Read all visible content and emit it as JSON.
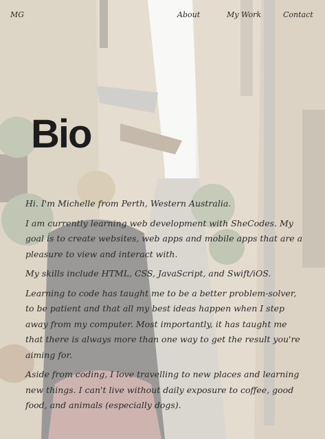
{
  "nav": {
    "brand": "MG",
    "links": [
      "About",
      "My Work",
      "Contact"
    ]
  },
  "page": {
    "title": "Bio"
  },
  "bio": {
    "paragraphs": [
      "Hi. I'm Michelle from Perth, Western Australia.",
      "I am currently learning web development with SheCodes. My goal is to create websites, web apps and mobile apps that are a pleasure to view and interact with.",
      "My skills include HTML, CSS, JavaScript, and Swift/iOS.",
      "Learning to code has taught me to be a better problem-solver, to be patient and that all my best ideas happen when I step away from my computer. Most importantly, it has taught me that there is always more than one way to get the result you're aiming for.",
      "Aside from coding, I love travelling to new places and learning new things. I can't live without daily exposure to coffee, good food, and animals (especially dogs)."
    ]
  },
  "colors": {
    "text": "#2a2a2a",
    "heading": "#1c1c1c"
  }
}
